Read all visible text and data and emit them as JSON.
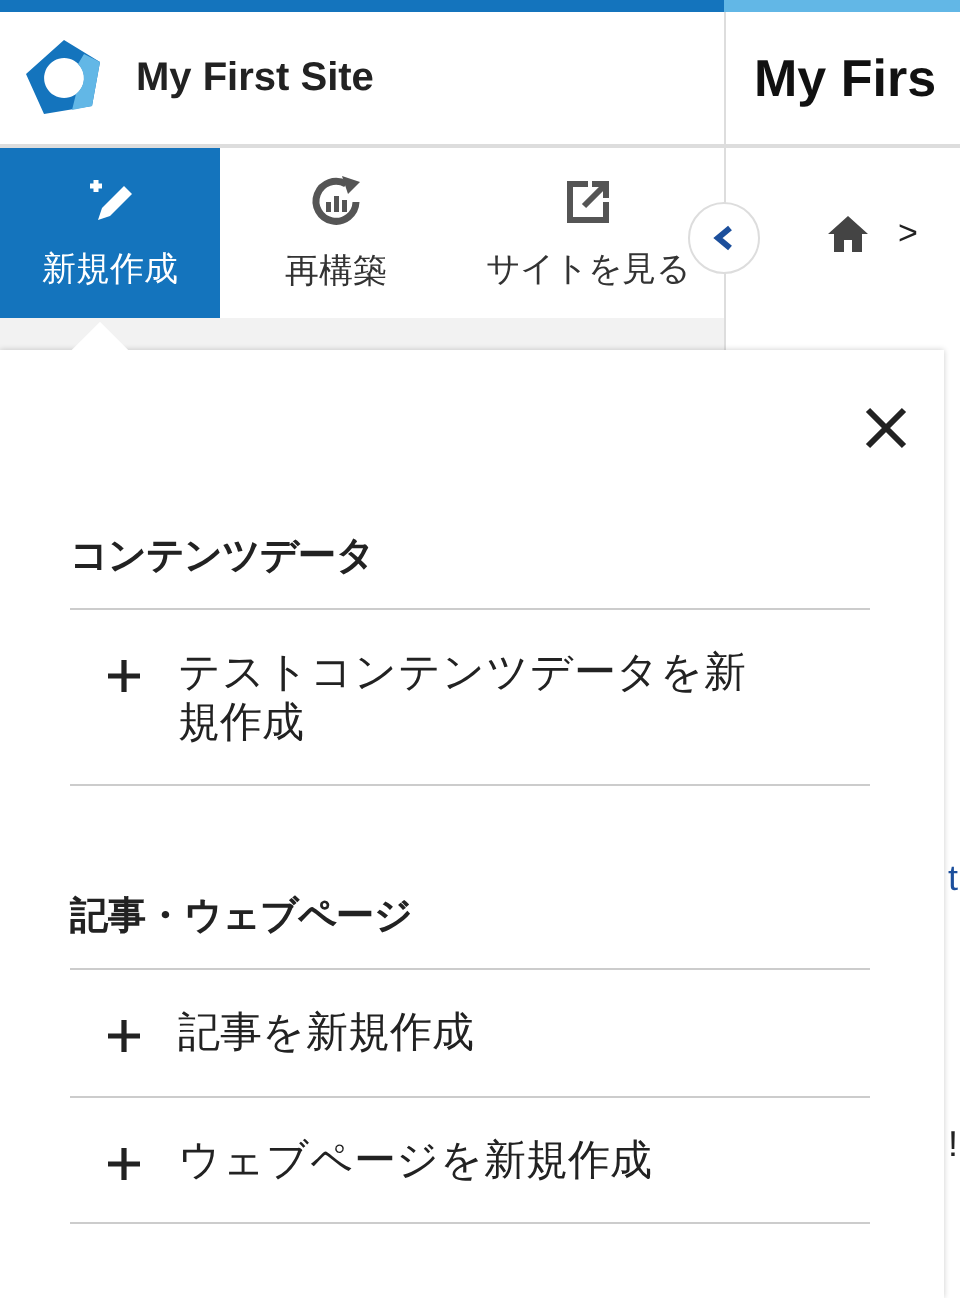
{
  "site": {
    "name": "My First Site"
  },
  "page_title": "My Firs",
  "toolbar": [
    {
      "label": "新規作成",
      "selected": true
    },
    {
      "label": "再構築",
      "selected": false
    },
    {
      "label": "サイトを見る",
      "selected": false
    }
  ],
  "breadcrumb": {
    "separator": ">"
  },
  "background_fragments": [
    {
      "text": "t",
      "kind": "link"
    },
    {
      "text": "!",
      "kind": "plain"
    }
  ],
  "popup": {
    "sections": [
      {
        "heading": "コンテンツデータ",
        "items": [
          "テストコンテンツデータを新規作成"
        ]
      },
      {
        "heading": "記事・ウェブページ",
        "items": [
          "記事を新規作成",
          "ウェブページを新規作成"
        ]
      }
    ]
  }
}
